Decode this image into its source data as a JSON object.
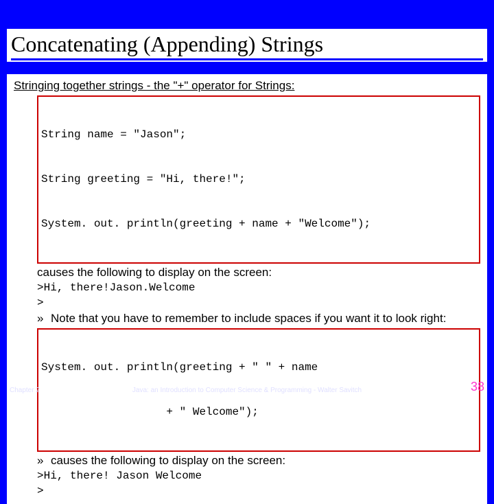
{
  "title": "Concatenating (Appending) Strings",
  "intro": "Stringing together strings - the \"+\" operator for Strings:",
  "code1_line1": "String name = \"Jason\";",
  "code1_line2": "String greeting = \"Hi, there!\";",
  "code1_line3": "System. out. println(greeting + name + \"Welcome\");",
  "causes1": "causes the following to display on the screen:",
  "output1_line1": ">Hi, there!Jason.Welcome",
  "output1_line2": ">",
  "bullet_mark": "»",
  "note_text": "Note that you have to remember to include spaces if you want it to look right:",
  "code2_line1": "System. out. println(greeting + \" \" + name",
  "code2_line2": "                   + \" Welcome\");",
  "causes2": "causes the following to display on the screen:",
  "output2_line1": ">Hi, there! Jason Welcome",
  "output2_line2": ">",
  "footer": {
    "left": "Chapter 2",
    "center": "Java: an Introduction to Computer Science & Programming - Walter Savitch",
    "right": "38"
  }
}
